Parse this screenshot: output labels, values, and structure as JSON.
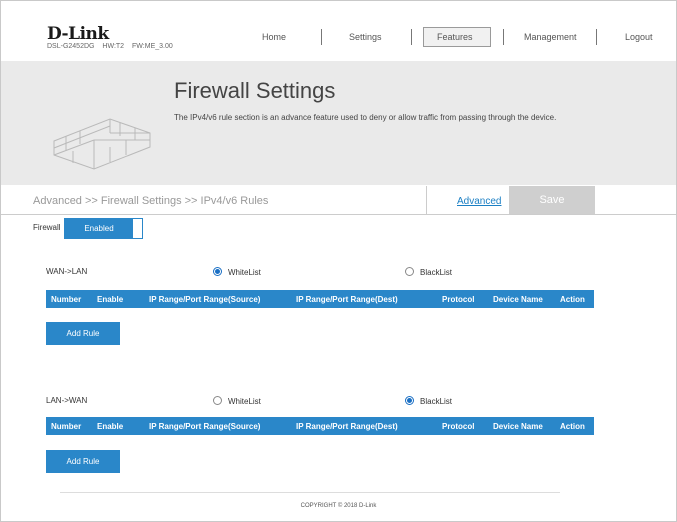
{
  "brand": {
    "logo": "D-Link",
    "model": "DSL-G2452DG",
    "hw": "HW:T2",
    "fw": "FW:ME_3.00"
  },
  "nav": {
    "home": "Home",
    "settings": "Settings",
    "features": "Features",
    "management": "Management",
    "logout": "Logout",
    "active": "Features"
  },
  "banner": {
    "title": "Firewall Settings",
    "description": "The IPv4/v6 rule section is an advance feature used to deny or allow traffic from passing through the device."
  },
  "pathbar": {
    "breadcrumb": "Advanced >> Firewall Settings >> IPv4/v6 Rules",
    "advanced_link": "Advanced",
    "save_label": "Save"
  },
  "firewall": {
    "label": "Firewall",
    "state": "Enabled"
  },
  "table_columns": [
    "Number",
    "Enable",
    "IP Range/Port Range(Source)",
    "IP Range/Port Range(Dest)",
    "Protocol",
    "Device Name",
    "Action"
  ],
  "wan_lan": {
    "label": "WAN->LAN",
    "whitelist": "WhiteList",
    "blacklist": "BlackList",
    "selected": "WhiteList",
    "add_rule": "Add Rule"
  },
  "lan_wan": {
    "label": "LAN->WAN",
    "whitelist": "WhiteList",
    "blacklist": "BlackList",
    "selected": "BlackList",
    "add_rule": "Add Rule"
  },
  "footer": {
    "copyright": "COPYRIGHT © 2018 D-Link"
  },
  "colors": {
    "accent": "#2a87c9",
    "banner_bg": "#eaeaea",
    "save_disabled": "#cfcfcf"
  }
}
